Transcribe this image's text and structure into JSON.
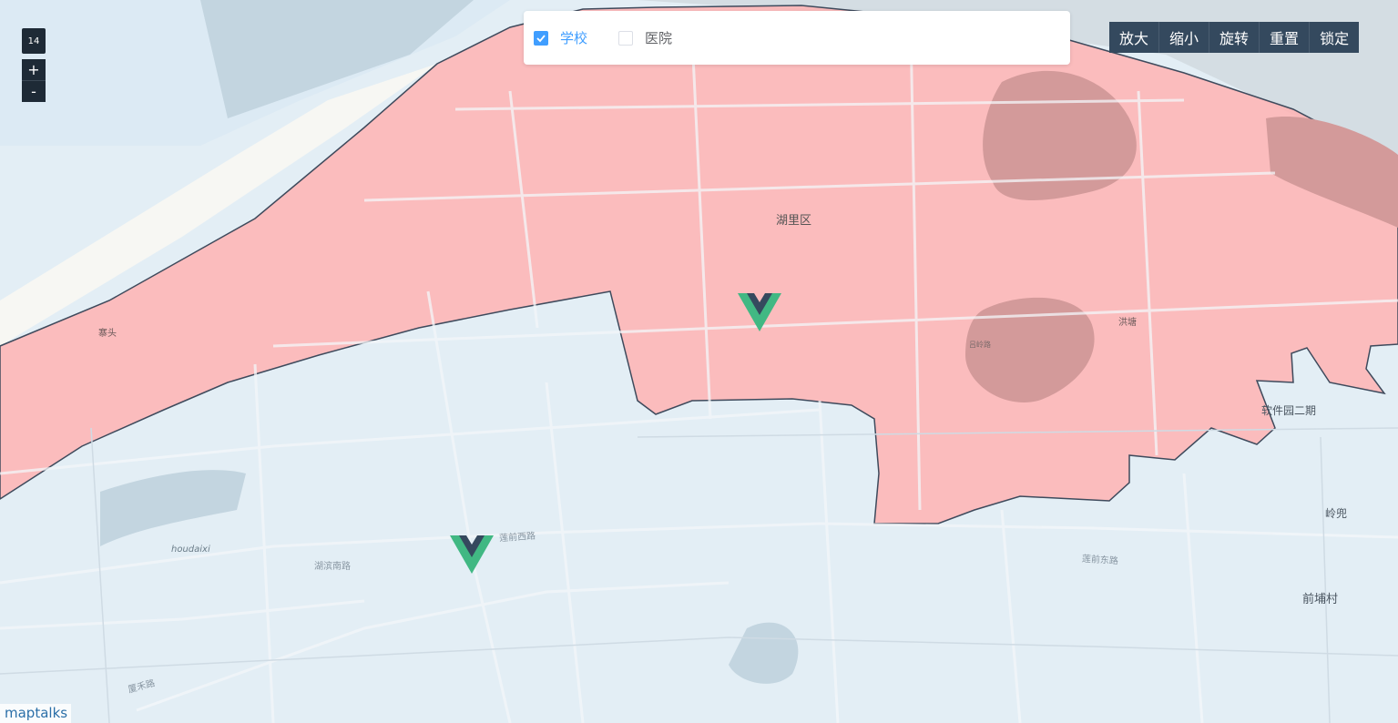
{
  "map": {
    "zoom_level": "14",
    "district_polygon_color": "#ffb3b3",
    "water_color": "#c8dbe6",
    "labels": {
      "district": "湖里区",
      "area_a": "寨头",
      "area_b": "洪塘",
      "community": "软件园二期",
      "village_a": "岭兜",
      "village_b": "前埔村",
      "river": "houdaixi",
      "road_a": "莲前西路",
      "road_b": "莲前东路",
      "road_c": "湖滨南路",
      "road_d": "厦禾路",
      "road_e": "吕岭路"
    },
    "markers": [
      {
        "name": "vue-marker",
        "icon": "vue-logo-icon"
      },
      {
        "name": "vue-marker",
        "icon": "vue-logo-icon"
      }
    ]
  },
  "zoom": {
    "in_label": "+",
    "out_label": "-"
  },
  "filter": {
    "items": [
      {
        "label": "学校",
        "checked": true
      },
      {
        "label": "医院",
        "checked": false
      }
    ]
  },
  "toolbar": {
    "zoom_in": "放大",
    "zoom_out": "缩小",
    "rotate": "旋转",
    "reset": "重置",
    "lock": "锁定"
  },
  "attribution": "maptalks"
}
